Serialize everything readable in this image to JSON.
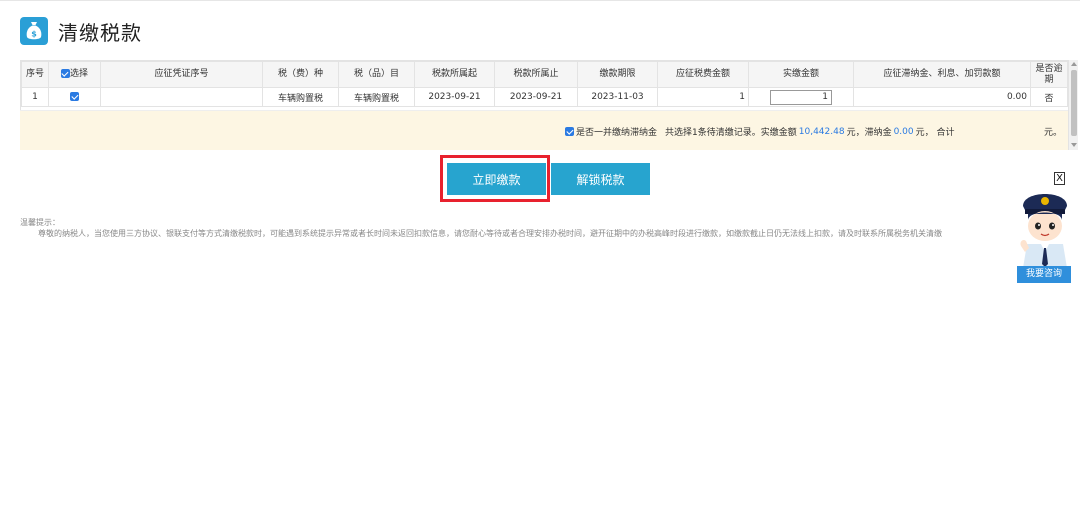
{
  "header": {
    "title": "清缴税款",
    "icon": "money-bag-icon"
  },
  "table": {
    "columns": [
      "序号",
      "选择",
      "应征凭证序号",
      "税（费）种",
      "税（品）目",
      "税款所属起",
      "税款所属止",
      "缴款期限",
      "应征税费金额",
      "实缴金额",
      "应征滞纳金、利息、加罚款额",
      "是否逾期"
    ],
    "rows": [
      {
        "index": "1",
        "selected": true,
        "voucher_no": "",
        "tax_type": "车辆购置税",
        "tax_item": "车辆购置税",
        "period_start": "2023-09-21",
        "period_end": "2023-09-21",
        "deadline": "2023-11-03",
        "tax_amount": "1",
        "paid_amount": "1",
        "late_fee": "0.00",
        "overdue": "否"
      }
    ]
  },
  "summary": {
    "late_fee_check_label": "是否一并缴纳滞纳金",
    "selected_prefix": "共选择1条待清缴记录。实缴金额",
    "paid_total": "10,442.48",
    "paid_suffix": "元，滞纳金",
    "late_total": "0.00",
    "late_suffix": "元，  合计",
    "unit": "元。"
  },
  "actions": {
    "pay_label": "立即缴款",
    "unlock_label": "解锁税款"
  },
  "tips": {
    "title": "温馨提示：",
    "body": "尊敬的纳税人，当您使用三方协议、银联支付等方式清缴税款时，可能遇到系统提示异常或者长时间未返回扣款信息，请您耐心等待或者合理安排办税时间，避开征期中的办税高峰时段进行缴款，如缴款截止日仍无法线上扣款，请及时联系所属税务机关清缴"
  },
  "assistant": {
    "close_label": "X",
    "consult_label": "我要咨询"
  },
  "colors": {
    "accent": "#27a4cf",
    "highlight": "#e8212e",
    "summary_bg": "#fdf6e3",
    "link_blue": "#2a7ae2"
  }
}
